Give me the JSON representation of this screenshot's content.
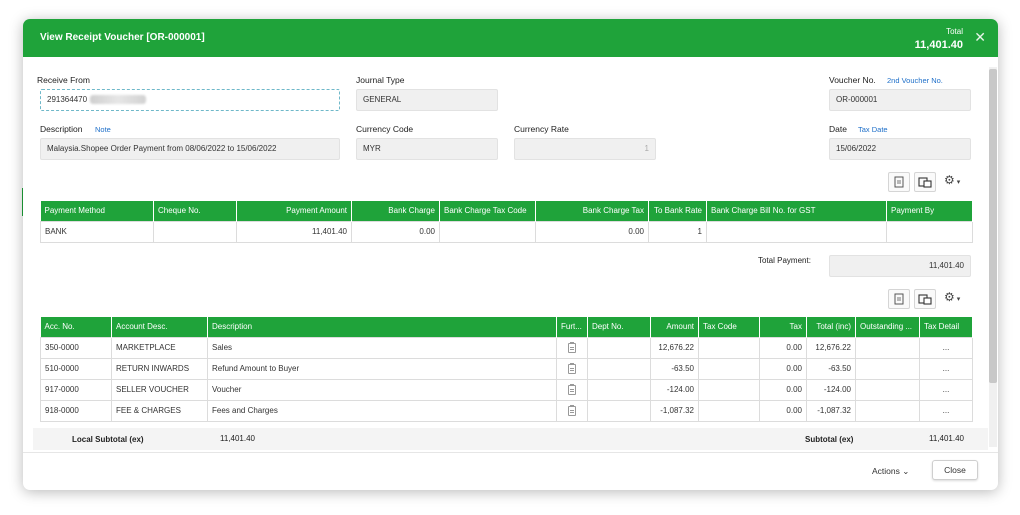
{
  "dialog": {
    "title": "View Receipt Voucher [OR-000001]",
    "total_label": "Total",
    "total_value": "11,401.40",
    "close_symbol": "✕"
  },
  "form": {
    "receive_from_label": "Receive From",
    "receive_from_value": "291364470",
    "journal_type_label": "Journal Type",
    "journal_type_value": "GENERAL",
    "voucher_no_label": "Voucher No.",
    "second_voucher_link": "2nd Voucher No.",
    "voucher_no_value": "OR-000001",
    "description_label": "Description",
    "note_link": "Note",
    "description_value": "Malaysia.Shopee Order Payment from 08/06/2022 to 15/06/2022",
    "currency_code_label": "Currency Code",
    "currency_code_value": "MYR",
    "currency_rate_label": "Currency Rate",
    "currency_rate_value": "1",
    "date_label": "Date",
    "tax_date_link": "Tax Date",
    "date_value": "15/06/2022"
  },
  "payment_table": {
    "headers": [
      "Payment Method",
      "Cheque No.",
      "Payment Amount",
      "Bank Charge",
      "Bank Charge Tax Code",
      "Bank Charge Tax",
      "To Bank Rate",
      "Bank Charge Bill No. for GST",
      "Payment By"
    ],
    "row": [
      "BANK",
      "",
      "11,401.40",
      "0.00",
      "",
      "0.00",
      "1",
      "",
      ""
    ],
    "total_payment_label": "Total Payment:",
    "total_payment_value": "11,401.40"
  },
  "detail_table": {
    "headers": [
      "Acc. No.",
      "Account Desc.",
      "Description",
      "Furt...",
      "Dept No.",
      "Amount",
      "Tax Code",
      "Tax",
      "Total (inc)",
      "Outstanding ...",
      "Tax Detail"
    ],
    "rows": [
      {
        "acc": "350-0000",
        "desc": "MARKETPLACE",
        "description": "Sales",
        "dept": "",
        "amount": "12,676.22",
        "tax_code": "",
        "tax": "0.00",
        "total": "12,676.22",
        "outstanding": "",
        "tax_detail": "..."
      },
      {
        "acc": "510-0000",
        "desc": "RETURN INWARDS",
        "description": "Refund Amount to Buyer",
        "dept": "",
        "amount": "-63.50",
        "tax_code": "",
        "tax": "0.00",
        "total": "-63.50",
        "outstanding": "",
        "tax_detail": "..."
      },
      {
        "acc": "917-0000",
        "desc": "SELLER VOUCHER",
        "description": "Voucher",
        "dept": "",
        "amount": "-124.00",
        "tax_code": "",
        "tax": "0.00",
        "total": "-124.00",
        "outstanding": "",
        "tax_detail": "..."
      },
      {
        "acc": "918-0000",
        "desc": "FEE & CHARGES",
        "description": "Fees and Charges",
        "dept": "",
        "amount": "-1,087.32",
        "tax_code": "",
        "tax": "0.00",
        "total": "-1,087.32",
        "outstanding": "",
        "tax_detail": "..."
      }
    ],
    "local_subtotal_label": "Local Subtotal (ex)",
    "local_subtotal_value": "11,401.40",
    "subtotal_label": "Subtotal (ex)",
    "subtotal_value": "11,401.40"
  },
  "footer": {
    "actions_label": "Actions ⌄",
    "close_label": "Close"
  },
  "icons": {
    "brand_color": "#1fa33a",
    "link_color": "#1e6fc9",
    "gear": "⚙"
  }
}
